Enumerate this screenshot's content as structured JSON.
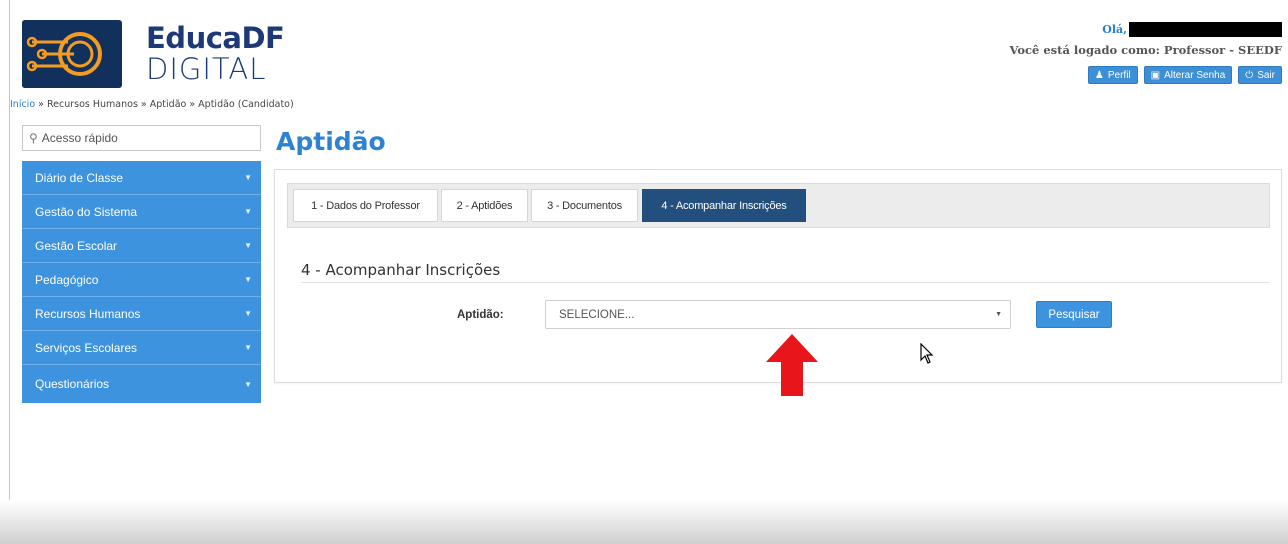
{
  "header": {
    "brand": "EducaDF",
    "brand_sub": "DIGITAL",
    "greeting": "Olá,",
    "logged_as": "Você está logado como: Professor - SEEDF",
    "buttons": [
      {
        "label": "Perfil",
        "icon": "user-icon"
      },
      {
        "label": "Alterar Senha",
        "icon": "lock-icon"
      },
      {
        "label": "Sair",
        "icon": "power-icon"
      }
    ]
  },
  "breadcrumb": {
    "home": "Início",
    "trail": " » Recursos Humanos » Aptidão » Aptidão (Candidato)"
  },
  "sidebar": {
    "quick_access_placeholder": "Acesso rápido",
    "items": [
      {
        "label": "Diário de Classe"
      },
      {
        "label": "Gestão do Sistema"
      },
      {
        "label": "Gestão Escolar"
      },
      {
        "label": "Pedagógico"
      },
      {
        "label": "Recursos Humanos"
      },
      {
        "label": "Serviços Escolares"
      },
      {
        "label": "Questionários"
      }
    ]
  },
  "main": {
    "title": "Aptidão",
    "tabs": [
      {
        "label": "1 - Dados do Professor",
        "active": false
      },
      {
        "label": "2 - Aptidões",
        "active": false
      },
      {
        "label": "3 - Documentos",
        "active": false
      },
      {
        "label": "4 - Acompanhar Inscrições",
        "active": true
      }
    ],
    "section_title": "4 - Acompanhar Inscrições",
    "field_label": "Aptidão:",
    "select_value": "SELECIONE...",
    "search_button": "Pesquisar"
  },
  "colors": {
    "accent": "#3d93dd",
    "active_tab": "#234f7e",
    "title": "#2d83d1",
    "annotation_arrow": "#e8161b"
  }
}
